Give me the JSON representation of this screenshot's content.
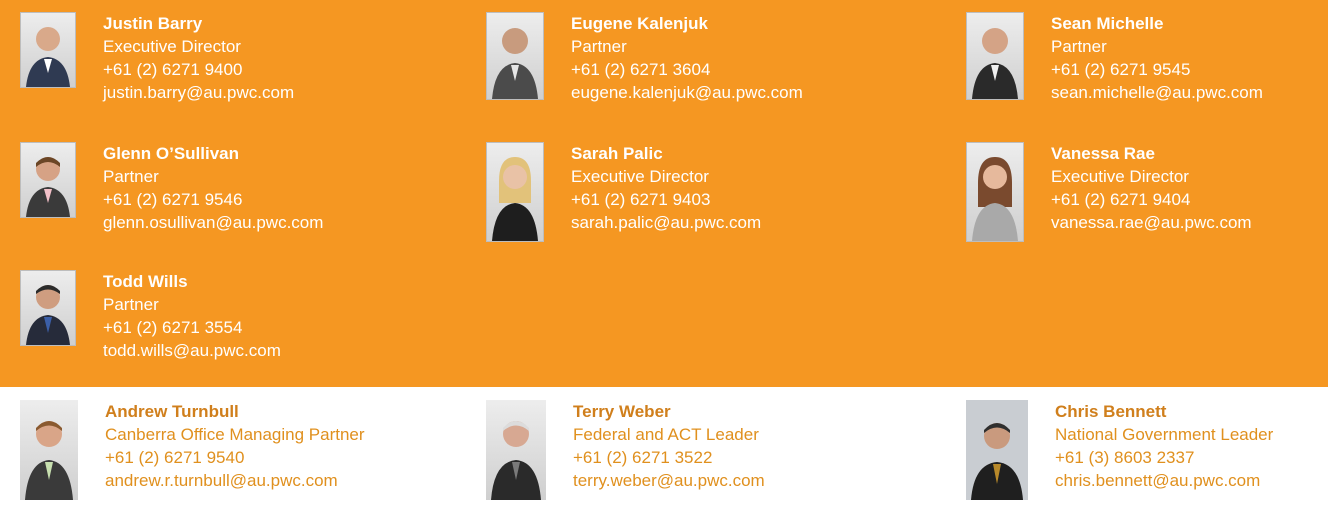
{
  "contacts": [
    {
      "name": "Justin Barry",
      "title": "Executive Director",
      "phone": "+61 (2) 6271 9400",
      "email": "justin.barry@au.pwc.com"
    },
    {
      "name": "Eugene Kalenjuk",
      "title": "Partner",
      "phone": "+61 (2) 6271 3604",
      "email": "eugene.kalenjuk@au.pwc.com"
    },
    {
      "name": "Sean Michelle",
      "title": "Partner",
      "phone": "+61 (2) 6271 9545",
      "email": "sean.michelle@au.pwc.com"
    },
    {
      "name": "Glenn O’Sullivan",
      "title": "Partner",
      "phone": "+61 (2) 6271 9546",
      "email": "glenn.osullivan@au.pwc.com"
    },
    {
      "name": "Sarah Palic",
      "title": "Executive Director",
      "phone": "+61 (2) 6271 9403",
      "email": "sarah.palic@au.pwc.com"
    },
    {
      "name": "Vanessa Rae",
      "title": "Executive Director",
      "phone": "+61 (2) 6271 9404",
      "email": "vanessa.rae@au.pwc.com"
    },
    {
      "name": "Todd Wills",
      "title": "Partner",
      "phone": "+61 (2) 6271 3554",
      "email": "todd.wills@au.pwc.com"
    }
  ],
  "leaders": [
    {
      "name": "Andrew Turnbull",
      "title": "Canberra Office Managing Partner",
      "phone": "+61 (2) 6271 9540",
      "email": "andrew.r.turnbull@au.pwc.com"
    },
    {
      "name": "Terry Weber",
      "title": "Federal and ACT Leader",
      "phone": "+61 (2) 6271 3522",
      "email": "terry.weber@au.pwc.com"
    },
    {
      "name": "Chris Bennett",
      "title": "National Government Leader",
      "phone": "+61 (3) 8603 2337",
      "email": "chris.bennett@au.pwc.com"
    }
  ],
  "colors": {
    "orange_band": "#f59722",
    "leader_name": "#d07f1c",
    "leader_text": "#e0901e"
  }
}
